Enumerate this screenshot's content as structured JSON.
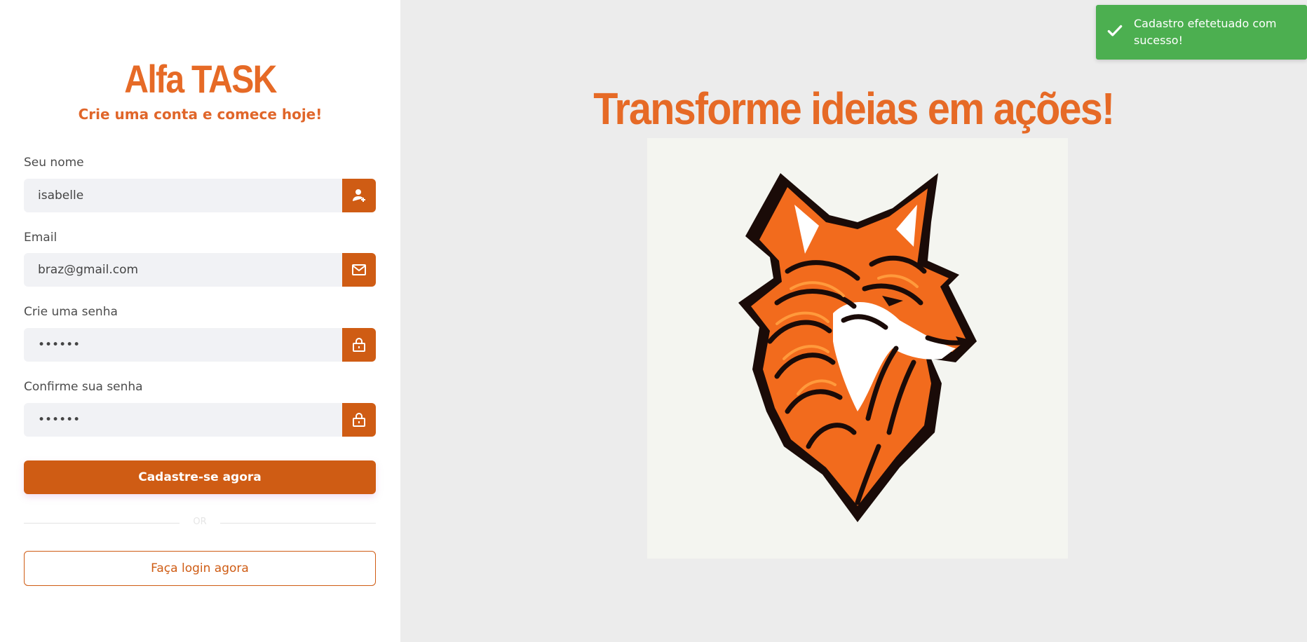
{
  "brand": {
    "title": "Alfa TASK",
    "subtitle": "Crie uma conta e comece hoje!"
  },
  "form": {
    "name": {
      "label": "Seu nome",
      "value": "isabelle",
      "icon": "user-plus-icon"
    },
    "email": {
      "label": "Email",
      "value": "braz@gmail.com",
      "icon": "mail-icon"
    },
    "password": {
      "label": "Crie uma senha",
      "value": "••••••",
      "icon": "lock-icon"
    },
    "confirm_password": {
      "label": "Confirme sua senha",
      "value": "••••••",
      "icon": "lock-icon"
    },
    "submit_label": "Cadastre-se agora",
    "divider_text": "OR",
    "login_label": "Faça login agora"
  },
  "hero": {
    "heading": "Transforme ideias em ações!",
    "image": "fox-logo-illustration"
  },
  "toast": {
    "message": "Cadastro efetetuado com sucesso!",
    "icon": "check-icon"
  },
  "colors": {
    "accent": "#cf5c14",
    "brand_text": "#e66a26",
    "toast_success": "#4caf50"
  }
}
